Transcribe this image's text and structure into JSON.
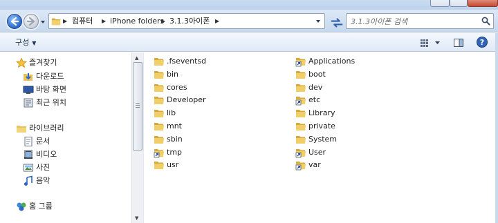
{
  "breadcrumb": [
    "컴퓨터",
    "iPhone folders",
    "3.1.3아이폰"
  ],
  "search": {
    "placeholder": "3.1.3아이폰 검색"
  },
  "toolbar": {
    "organize_label": "구성"
  },
  "sidebar": {
    "favorites": {
      "label": "즐겨찾기",
      "items": [
        "다운로드",
        "바탕 화면",
        "최근 위치"
      ]
    },
    "libraries": {
      "label": "라이브러리",
      "items": [
        "문서",
        "비디오",
        "사진",
        "음악"
      ]
    },
    "homegroup": {
      "label": "홈 그룹"
    }
  },
  "files": {
    "left": [
      ".fseventsd",
      "bin",
      "cores",
      "Developer",
      "lib",
      "mnt",
      "sbin",
      "tmp",
      "usr"
    ],
    "right": [
      "Applications",
      "boot",
      "dev",
      "etc",
      "Library",
      "private",
      "System",
      "User",
      "var"
    ]
  },
  "shortcut_items": [
    "tmp",
    "Applications",
    "etc",
    "User",
    "var"
  ],
  "colors": {
    "folder": "#e8c25a",
    "accent": "#2a67c6",
    "nav_bg": "#c6d8ee"
  }
}
